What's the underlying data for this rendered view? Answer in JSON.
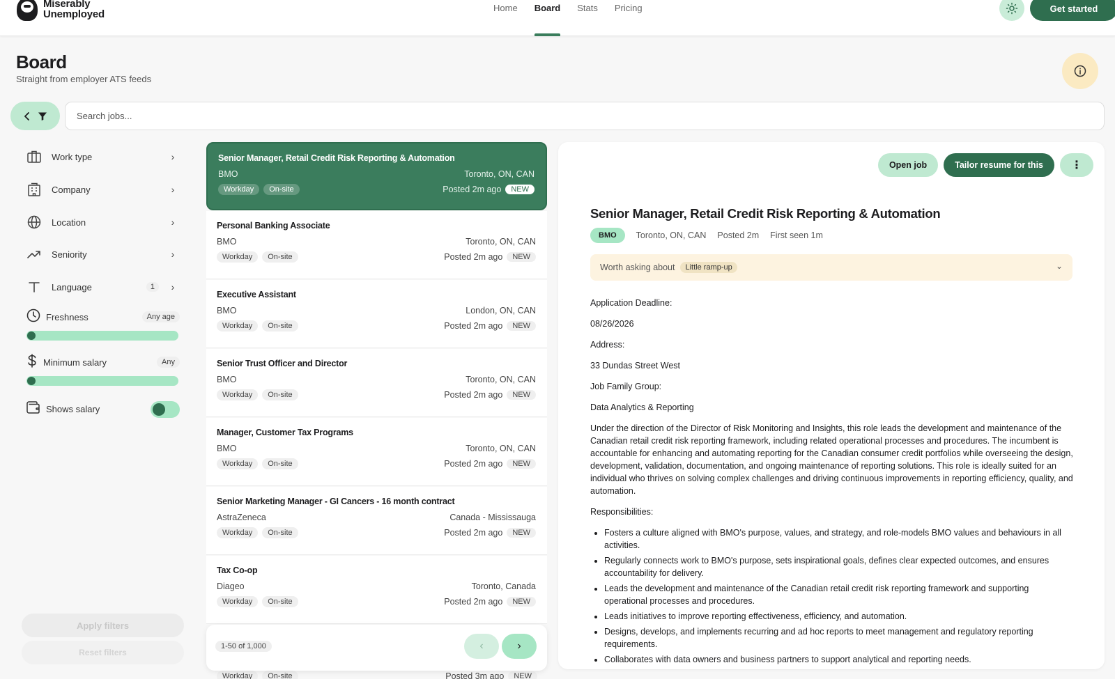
{
  "brand": {
    "line1": "Miserably",
    "line2": "Unemployed"
  },
  "nav": [
    "Home",
    "Board",
    "Stats",
    "Pricing"
  ],
  "header": {
    "cta_label": "Get started",
    "theme_icon": "sun-icon"
  },
  "page": {
    "title": "Board",
    "subtitle": "Straight from employer ATS feeds"
  },
  "search": {
    "placeholder": "Search jobs..."
  },
  "filters": {
    "work_type": "Work type",
    "company": "Company",
    "location": "Location",
    "seniority": "Seniority",
    "language": "Language",
    "language_count": "1",
    "freshness": "Freshness",
    "freshness_value": "Any age",
    "min_salary": "Minimum salary",
    "min_salary_value": "Any",
    "shows_salary": "Shows salary",
    "apply_label": "Apply filters",
    "reset_label": "Reset filters"
  },
  "jobs": [
    {
      "title": "Senior Manager, Retail Credit Risk Reporting & Automation",
      "company": "BMO",
      "location": "Toronto, ON, CAN",
      "tags": [
        "Workday",
        "On-site"
      ],
      "posted": "Posted 2m ago",
      "badge": "NEW"
    },
    {
      "title": "Personal Banking Associate",
      "company": "BMO",
      "location": "Toronto, ON, CAN",
      "tags": [
        "Workday",
        "On-site"
      ],
      "posted": "Posted 2m ago",
      "badge": "NEW"
    },
    {
      "title": "Executive Assistant",
      "company": "BMO",
      "location": "London, ON, CAN",
      "tags": [
        "Workday",
        "On-site"
      ],
      "posted": "Posted 2m ago",
      "badge": "NEW"
    },
    {
      "title": "Senior Trust Officer and Director",
      "company": "BMO",
      "location": "Toronto, ON, CAN",
      "tags": [
        "Workday",
        "On-site"
      ],
      "posted": "Posted 2m ago",
      "badge": "NEW"
    },
    {
      "title": "Manager, Customer Tax Programs",
      "company": "BMO",
      "location": "Toronto, ON, CAN",
      "tags": [
        "Workday",
        "On-site"
      ],
      "posted": "Posted 2m ago",
      "badge": "NEW"
    },
    {
      "title": "Senior Marketing Manager - GI Cancers - 16 month contract",
      "company": "AstraZeneca",
      "location": "Canada - Mississauga",
      "tags": [
        "Workday",
        "On-site"
      ],
      "posted": "Posted 2m ago",
      "badge": "NEW"
    },
    {
      "title": "Tax Co-op",
      "company": "Diageo",
      "location": "Toronto, Canada",
      "tags": [
        "Workday",
        "On-site"
      ],
      "posted": "Posted 2m ago",
      "badge": "NEW"
    }
  ],
  "peek": {
    "tags": [
      "Workday",
      "On-site"
    ],
    "posted": "Posted 3m ago",
    "badge": "NEW"
  },
  "pager": {
    "count": "1-50 of 1,000"
  },
  "detail": {
    "open_label": "Open job",
    "tailor_label": "Tailor resume for this",
    "title": "Senior Manager, Retail Credit Risk Reporting & Automation",
    "company": "BMO",
    "location": "Toronto, ON, CAN",
    "posted": "Posted 2m",
    "first_seen": "First seen 1m",
    "ask_label": "Worth asking about",
    "ask_tag": "Little ramp-up",
    "paragraphs": [
      "Application Deadline:",
      "08/26/2026",
      "Address:",
      "33 Dundas Street West",
      "Job Family Group:",
      "Data Analytics & Reporting",
      "Under the direction of the Director of Risk Monitoring and Insights, this role leads the development and maintenance of the Canadian retail credit risk reporting framework, including related operational processes and procedures. The incumbent is accountable for enhancing and automating reporting for the Canadian consumer credit portfolios while overseeing the design, development, validation, documentation, and ongoing maintenance of reporting solutions. This role is ideally suited for an individual who thrives on solving complex challenges and driving continuous improvements in reporting efficiency, quality, and automation.",
      "Responsibilities:"
    ],
    "bullets": [
      "Fosters a culture aligned with BMO's purpose, values, and strategy, and role-models BMO values and behaviours in all activities.",
      "Regularly connects work to BMO's purpose, sets inspirational goals, defines clear expected outcomes, and ensures accountability for delivery.",
      "Leads the development and maintenance of the Canadian retail credit risk reporting framework and supporting operational processes and procedures.",
      "Leads initiatives to improve reporting effectiveness, efficiency, and automation.",
      "Designs, develops, and implements recurring and ad hoc reports to meet management and regulatory reporting requirements.",
      "Collaborates with data owners and business partners to support analytical and reporting needs."
    ]
  },
  "colors": {
    "accent": "#2f6e4f",
    "accent_light": "#a6e6c4",
    "selected_card": "#3b7d5d",
    "warning_bg": "#fdf3e0"
  }
}
